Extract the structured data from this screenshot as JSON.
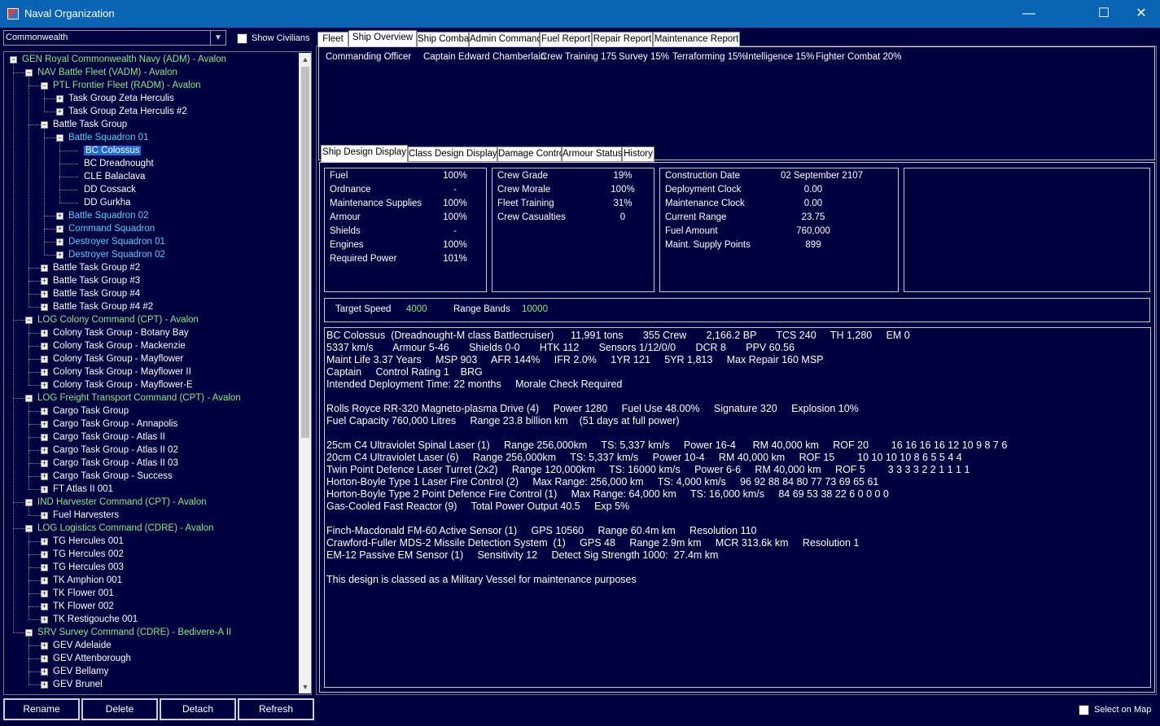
{
  "window": {
    "title": "Naval Organization",
    "minimize": "—",
    "maximize": "☐",
    "close": "✕"
  },
  "left": {
    "race_select": "Commonwealth",
    "show_civilians": "Show Civilians",
    "buttons": {
      "rename": "Rename",
      "delete": "Delete",
      "detach": "Detach",
      "refresh": "Refresh"
    }
  },
  "tree": [
    {
      "label": "GEN Royal Commonwealth Navy  (ADM)  -  Avalon",
      "level": 0,
      "color": "green",
      "exp": "−"
    },
    {
      "label": "NAV Battle Fleet  (VADM)  -  Avalon",
      "level": 1,
      "color": "green",
      "exp": "−"
    },
    {
      "label": "PTL Frontier Fleet  (RADM)  -  Avalon",
      "level": 2,
      "color": "green",
      "exp": "−"
    },
    {
      "label": "Task Group Zeta Herculis",
      "level": 3,
      "color": "white",
      "exp": "+"
    },
    {
      "label": "Task Group Zeta Herculis #2",
      "level": 3,
      "color": "white",
      "exp": "+"
    },
    {
      "label": "Battle Task Group",
      "level": 2,
      "color": "white",
      "exp": "−"
    },
    {
      "label": "Battle Squadron 01",
      "level": 3,
      "color": "cyan",
      "exp": "−"
    },
    {
      "label": "BC Colossus",
      "level": 4,
      "color": "white",
      "exp": "",
      "selected": true
    },
    {
      "label": "BC Dreadnought",
      "level": 4,
      "color": "white",
      "exp": ""
    },
    {
      "label": "CLE Balaclava",
      "level": 4,
      "color": "white",
      "exp": ""
    },
    {
      "label": "DD Cossack",
      "level": 4,
      "color": "white",
      "exp": ""
    },
    {
      "label": "DD Gurkha",
      "level": 4,
      "color": "white",
      "exp": ""
    },
    {
      "label": "Battle Squadron 02",
      "level": 3,
      "color": "cyan",
      "exp": "+"
    },
    {
      "label": "Command Squadron",
      "level": 3,
      "color": "cyan",
      "exp": "+"
    },
    {
      "label": "Destroyer Squadron 01",
      "level": 3,
      "color": "cyan",
      "exp": "+"
    },
    {
      "label": "Destroyer Squadron 02",
      "level": 3,
      "color": "cyan",
      "exp": "+"
    },
    {
      "label": "Battle Task Group #2",
      "level": 2,
      "color": "white",
      "exp": "+"
    },
    {
      "label": "Battle Task Group #3",
      "level": 2,
      "color": "white",
      "exp": "+"
    },
    {
      "label": "Battle Task Group #4",
      "level": 2,
      "color": "white",
      "exp": "+"
    },
    {
      "label": "Battle Task Group #4 #2",
      "level": 2,
      "color": "white",
      "exp": "+"
    },
    {
      "label": "LOG Colony Command  (CPT)  -  Avalon",
      "level": 1,
      "color": "green",
      "exp": "−"
    },
    {
      "label": "Colony Task Group - Botany Bay",
      "level": 2,
      "color": "white",
      "exp": "+"
    },
    {
      "label": "Colony Task Group - Mackenzie",
      "level": 2,
      "color": "white",
      "exp": "+"
    },
    {
      "label": "Colony Task Group - Mayflower",
      "level": 2,
      "color": "white",
      "exp": "+"
    },
    {
      "label": "Colony Task Group - Mayflower II",
      "level": 2,
      "color": "white",
      "exp": "+"
    },
    {
      "label": "Colony Task Group - Mayflower-E",
      "level": 2,
      "color": "white",
      "exp": "+"
    },
    {
      "label": "LOG Freight Transport Command  (CPT)  -  Avalon",
      "level": 1,
      "color": "green",
      "exp": "−"
    },
    {
      "label": "Cargo Task Group",
      "level": 2,
      "color": "white",
      "exp": "+"
    },
    {
      "label": "Cargo Task Group - Annapolis",
      "level": 2,
      "color": "white",
      "exp": "+"
    },
    {
      "label": "Cargo Task Group - Atlas II",
      "level": 2,
      "color": "white",
      "exp": "+"
    },
    {
      "label": "Cargo Task Group - Atlas II 02",
      "level": 2,
      "color": "white",
      "exp": "+"
    },
    {
      "label": "Cargo Task Group - Atlas II 03",
      "level": 2,
      "color": "white",
      "exp": "+"
    },
    {
      "label": "Cargo Task Group - Success",
      "level": 2,
      "color": "white",
      "exp": "+"
    },
    {
      "label": "FT Atlas II 001",
      "level": 2,
      "color": "white",
      "exp": "+"
    },
    {
      "label": "IND Harvester Command  (CPT)  -  Avalon",
      "level": 1,
      "color": "green",
      "exp": "−"
    },
    {
      "label": "Fuel Harvesters",
      "level": 2,
      "color": "white",
      "exp": "+"
    },
    {
      "label": "LOG Logistics Command  (CDRE)  -  Avalon",
      "level": 1,
      "color": "green",
      "exp": "−"
    },
    {
      "label": "TG Hercules 001",
      "level": 2,
      "color": "white",
      "exp": "+"
    },
    {
      "label": "TG Hercules 002",
      "level": 2,
      "color": "white",
      "exp": "+"
    },
    {
      "label": "TG Hercules 003",
      "level": 2,
      "color": "white",
      "exp": "+"
    },
    {
      "label": "TK Amphion 001",
      "level": 2,
      "color": "white",
      "exp": "+"
    },
    {
      "label": "TK Flower 001",
      "level": 2,
      "color": "white",
      "exp": "+"
    },
    {
      "label": "TK Flower 002",
      "level": 2,
      "color": "white",
      "exp": "+"
    },
    {
      "label": "TK Restigouche 001",
      "level": 2,
      "color": "white",
      "exp": "+"
    },
    {
      "label": "SRV Survey Command  (CDRE)  -  Bedivere-A II",
      "level": 1,
      "color": "green",
      "exp": "−"
    },
    {
      "label": "GEV Adelaide",
      "level": 2,
      "color": "white",
      "exp": "+"
    },
    {
      "label": "GEV Attenborough",
      "level": 2,
      "color": "white",
      "exp": "+"
    },
    {
      "label": "GEV Bellamy",
      "level": 2,
      "color": "white",
      "exp": "+"
    },
    {
      "label": "GEV Brunel",
      "level": 2,
      "color": "white",
      "exp": "+"
    }
  ],
  "main_tabs": [
    "Fleet",
    "Ship Overview",
    "Ship Combat",
    "Admin Command",
    "Fuel Report",
    "Repair Report",
    "Maintenance Report"
  ],
  "main_tab_active": "Ship Overview",
  "summary": {
    "co_label": "Commanding Officer",
    "co_name": "Captain Edward Chamberlain",
    "crew_training": "Crew Training 175",
    "survey": "Survey 15%",
    "terraforming": "Terraforming 15%",
    "intelligence": "Intelligence 15%",
    "fighter_combat": "Fighter Combat 20%"
  },
  "sub_tabs": [
    "Ship Design Display",
    "Class Design Display",
    "Damage Control",
    "Armour Status",
    "History"
  ],
  "sub_tab_active": "Ship Design Display",
  "status": [
    {
      "label": "Fuel",
      "value": "100%"
    },
    {
      "label": "Ordnance",
      "value": "-"
    },
    {
      "label": "Maintenance Supplies",
      "value": "100%"
    },
    {
      "label": "Armour",
      "value": "100%"
    },
    {
      "label": "Shields",
      "value": "-"
    },
    {
      "label": "Engines",
      "value": "100%"
    },
    {
      "label": "Required Power",
      "value": "101%"
    }
  ],
  "crew": [
    {
      "label": "Crew Grade",
      "value": "19%"
    },
    {
      "label": "Crew Morale",
      "value": "100%"
    },
    {
      "label": "Fleet Training",
      "value": "31%"
    },
    {
      "label": "Crew Casualties",
      "value": "0"
    }
  ],
  "logistics": [
    {
      "label": "Construction Date",
      "value": "02 September 2107"
    },
    {
      "label": "Deployment Clock",
      "value": "0.00"
    },
    {
      "label": "Maintenance Clock",
      "value": "0.00"
    },
    {
      "label": "Current Range",
      "value": "23.75"
    },
    {
      "label": "Fuel Amount",
      "value": "760,000"
    },
    {
      "label": "Maint. Supply Points",
      "value": "899"
    }
  ],
  "speed": {
    "target_label": "Target Speed",
    "target_value": "4000",
    "range_label": "Range Bands",
    "range_value": "10000"
  },
  "design_lines": [
    "BC Colossus  (Dreadnought-M class Battlecruiser)      11,991 tons       355 Crew       2,166.2 BP       TCS 240     TH 1,280     EM 0",
    "5337 km/s       Armour 5-46       Shields 0-0       HTK 112       Sensors 1/12/0/0       DCR 8       PPV 60.56",
    "Maint Life 3.37 Years     MSP 903     AFR 144%     IFR 2.0%     1YR 121     5YR 1,813     Max Repair 160 MSP",
    "Captain     Control Rating 1    BRG",
    "Intended Deployment Time: 22 months     Morale Check Required",
    "",
    "Rolls Royce RR-320 Magneto-plasma Drive (4)     Power 1280     Fuel Use 48.00%     Signature 320     Explosion 10%",
    "Fuel Capacity 760,000 Litres     Range 23.8 billion km    (51 days at full power)",
    "",
    "25cm C4 Ultraviolet Spinal Laser (1)     Range 256,000km     TS: 5,337 km/s     Power 16-4      RM 40,000 km     ROF 20        16 16 16 16 12 10 9 8 7 6",
    "20cm C4 Ultraviolet Laser (6)     Range 256,000km     TS: 5,337 km/s     Power 10-4     RM 40,000 km     ROF 15        10 10 10 10 8 6 5 5 4 4",
    "Twin Point Defence Laser Turret (2x2)     Range 120,000km     TS: 16000 km/s     Power 6-6     RM 40,000 km     ROF 5        3 3 3 3 2 2 1 1 1 1",
    "Horton-Boyle Type 1 Laser Fire Control (2)     Max Range: 256,000 km     TS: 4,000 km/s     96 92 88 84 80 77 73 69 65 61",
    "Horton-Boyle Type 2 Point Defence Fire Control (1)     Max Range: 64,000 km     TS: 16,000 km/s     84 69 53 38 22 6 0 0 0 0",
    "Gas-Cooled Fast Reactor (9)     Total Power Output 40.5     Exp 5%",
    "",
    "Finch-Macdonald FM-60 Active Sensor (1)     GPS 10560     Range 60.4m km     Resolution 110",
    "Crawford-Fuller MDS-2 Missile Detection System  (1)     GPS 48     Range 2.9m km     MCR 313.6k km     Resolution 1",
    "EM-12 Passive EM Sensor (1)     Sensitivity 12     Detect Sig Strength 1000:  27.4m km",
    "",
    "This design is classed as a Military Vessel for maintenance purposes"
  ],
  "footer": {
    "select_on_map": "Select on Map"
  },
  "colors": {
    "bg": "#000040",
    "titlebar": "#0a64b4",
    "green": "#7cf07c",
    "cyan": "#3fd6f8",
    "selection": "#1a6be0"
  }
}
